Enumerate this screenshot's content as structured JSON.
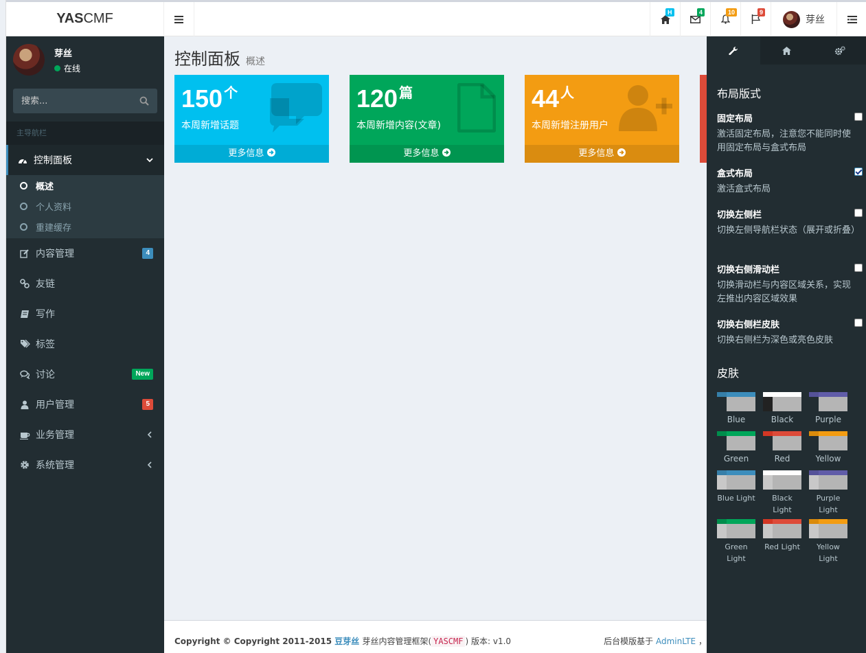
{
  "header": {
    "logo_bold": "YAS",
    "logo_rest": "CMF",
    "badges": {
      "home": "H",
      "mail": "4",
      "bell": "10",
      "flag": "9"
    },
    "user_name": "芽丝"
  },
  "sidebar": {
    "user_name": "芽丝",
    "status": "在线",
    "search_placeholder": "搜索...",
    "section": "主导航栏",
    "items": [
      {
        "label": "控制面板",
        "icon": "dashboard-icon"
      },
      {
        "label": "内容管理",
        "icon": "edit-icon",
        "badge": "4"
      },
      {
        "label": "友链",
        "icon": "link-icon"
      },
      {
        "label": "写作",
        "icon": "book-icon"
      },
      {
        "label": "标签",
        "icon": "tags-icon"
      },
      {
        "label": "讨论",
        "icon": "comments-icon",
        "badge": "New"
      },
      {
        "label": "用户管理",
        "icon": "user-icon",
        "badge": "5"
      },
      {
        "label": "业务管理",
        "icon": "coffee-icon"
      },
      {
        "label": "系统管理",
        "icon": "cog-icon"
      }
    ],
    "submenu": [
      "概述",
      "个人资料",
      "重建缓存"
    ]
  },
  "page": {
    "title": "控制面板",
    "subtitle": "概述"
  },
  "stats": [
    {
      "value": "150",
      "unit": "个",
      "label": "本周新增话题",
      "more": "更多信息",
      "color": "#00c0ef",
      "icon": "comments-icon"
    },
    {
      "value": "120",
      "unit": "篇",
      "label": "本周新增内容(文章)",
      "more": "更多信息",
      "color": "#00a65a",
      "icon": "file-icon"
    },
    {
      "value": "44",
      "unit": "人",
      "label": "本周新增注册用户",
      "more": "更多信息",
      "color": "#f39c12",
      "icon": "user-plus-icon"
    }
  ],
  "footer": {
    "copyright": "Copyright © Copyright 2011-2015",
    "brand": "豆芽丝",
    "text1": "芽丝内容管理框架(",
    "code": "YASCMF",
    "text2": ") 版本: v1.0",
    "right_text": "后台模版基于",
    "right_link": "AdminLTE",
    "right_tail": "，"
  },
  "control_sidebar": {
    "layout_heading": "布局版式",
    "options": [
      {
        "title": "固定布局",
        "desc": "激活固定布局，注意您不能同时使用固定布局与盒式布局",
        "checked": false
      },
      {
        "title": "盒式布局",
        "desc": "激活盒式布局",
        "checked": true
      },
      {
        "title": "切换左侧栏",
        "desc": "切换左侧导航栏状态（展开或折叠）",
        "checked": false
      },
      {
        "title": "切换右侧滑动栏",
        "desc": "切换滑动栏与内容区域关系，实现左推出内容区域效果",
        "checked": false
      },
      {
        "title": "切换右侧栏皮肤",
        "desc": "切换右侧栏为深色或亮色皮肤",
        "checked": false
      }
    ],
    "skins_heading": "皮肤",
    "skins": [
      {
        "name": "Blue",
        "color": "#367fa9"
      },
      {
        "name": "Black",
        "color": "#fefefe"
      },
      {
        "name": "Purple",
        "color": "#555299"
      },
      {
        "name": "Green",
        "color": "#008d4c"
      },
      {
        "name": "Red",
        "color": "#d33724"
      },
      {
        "name": "Yellow",
        "color": "#db8b0b"
      },
      {
        "name": "Blue Light",
        "color": "#367fa9"
      },
      {
        "name": "Black Light",
        "color": "#fefefe"
      },
      {
        "name": "Purple Light",
        "color": "#555299"
      },
      {
        "name": "Green Light",
        "color": "#008d4c"
      },
      {
        "name": "Red Light",
        "color": "#d33724"
      },
      {
        "name": "Yellow Light",
        "color": "#db8b0b"
      }
    ]
  }
}
